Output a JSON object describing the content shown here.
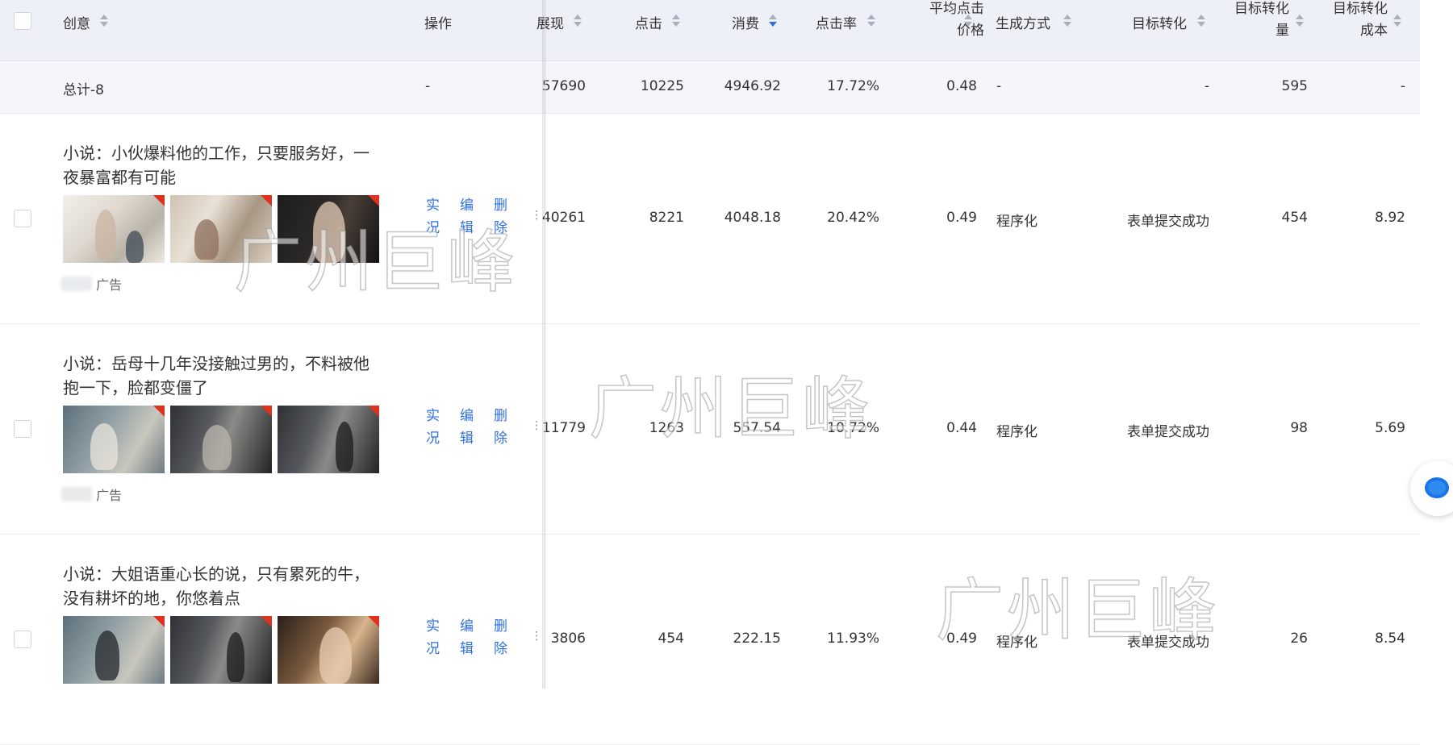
{
  "header": {
    "creative": "创意",
    "operation": "操作",
    "impressions": "展现",
    "clicks": "点击",
    "cost": "消费",
    "ctr": "点击率",
    "avg_cpc_line1": "平均点击",
    "avg_cpc_line2": "价格",
    "gen_method": "生成方式",
    "target_conv": "目标转化",
    "target_conv_count_line1": "目标转化",
    "target_conv_count_line2": "量",
    "target_conv_cost_line1": "目标转化",
    "target_conv_cost_line2": "成本"
  },
  "total": {
    "label": "总计-8",
    "operation": "-",
    "impressions": "57690",
    "clicks": "10225",
    "cost": "4946.92",
    "ctr": "17.72%",
    "avg_cpc": "0.48",
    "gen_method": "-",
    "target_conv": "-",
    "target_conv_count": "595",
    "target_conv_cost": "-"
  },
  "rows": [
    {
      "title": "小说：小伙爆料他的工作，只要服务好，一夜暴富都有可能",
      "ad_label": "广告",
      "op_live": "实况",
      "op_edit": "编辑",
      "op_delete": "删除",
      "impressions": "40261",
      "clicks": "8221",
      "cost": "4048.18",
      "ctr": "20.42%",
      "avg_cpc": "0.49",
      "gen_method": "程序化",
      "target_conv": "表单提交成功",
      "target_conv_count": "454",
      "target_conv_cost": "8.92"
    },
    {
      "title": "小说：岳母十几年没接触过男的，不料被他抱一下，脸都变僵了",
      "ad_label": "广告",
      "op_live": "实况",
      "op_edit": "编辑",
      "op_delete": "删除",
      "impressions": "11779",
      "clicks": "1263",
      "cost": "557.54",
      "ctr": "10.72%",
      "avg_cpc": "0.44",
      "gen_method": "程序化",
      "target_conv": "表单提交成功",
      "target_conv_count": "98",
      "target_conv_cost": "5.69"
    },
    {
      "title": "小说：大姐语重心长的说，只有累死的牛，没有耕坏的地，你悠着点",
      "ad_label": "",
      "op_live": "实况",
      "op_edit": "编辑",
      "op_delete": "删除",
      "impressions": "3806",
      "clicks": "454",
      "cost": "222.15",
      "ctr": "11.93%",
      "avg_cpc": "0.49",
      "gen_method": "程序化",
      "target_conv": "表单提交成功",
      "target_conv_count": "26",
      "target_conv_cost": "8.54"
    }
  ],
  "watermark": "广州巨峰"
}
